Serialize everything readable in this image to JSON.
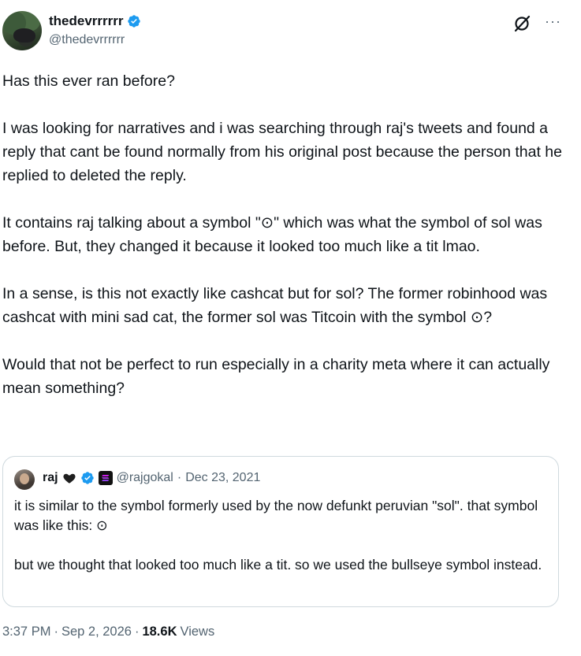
{
  "author": {
    "display_name": "thedevrrrrrr",
    "handle": "@thedevrrrrrr"
  },
  "more_glyph": "···",
  "tweet": {
    "paragraphs": [
      "Has this ever ran before?",
      "I was looking for narratives and i was searching through raj's tweets and found a reply that cant be found normally from his original post because the person that he replied to deleted the reply.",
      "It contains raj talking about a symbol \"⊙\" which was what the symbol of sol was before. But, they changed it because it looked too much like a tit lmao.",
      "In a sense, is this not exactly like cashcat but for sol? The former robinhood was cashcat with mini sad cat, the former sol was Titcoin with the symbol ⊙?",
      "Would that not be perfect to run especially in a charity meta where it can actually mean something?"
    ]
  },
  "quote": {
    "name": "raj",
    "handle": "@rajgokal",
    "separator": "·",
    "date": "Dec 23, 2021",
    "paragraphs": [
      "it is similar to the symbol formerly used by the now defunkt peruvian \"sol\". that symbol was like this: ⊙",
      "but we thought that looked too much like a tit. so we used the bullseye symbol instead."
    ]
  },
  "meta": {
    "time": "3:37 PM",
    "dot1": "·",
    "date": "Sep 2, 2026",
    "dot2": "·",
    "views_count": "18.6K",
    "views_label": "Views"
  },
  "colors": {
    "verified_blue": "#1d9bf0",
    "muted_text": "#536471",
    "border": "#cfd9de"
  },
  "icons": [
    "verified-badge-icon",
    "grok-icon",
    "more-icon",
    "black-heart-icon",
    "solana-badge-icon"
  ]
}
